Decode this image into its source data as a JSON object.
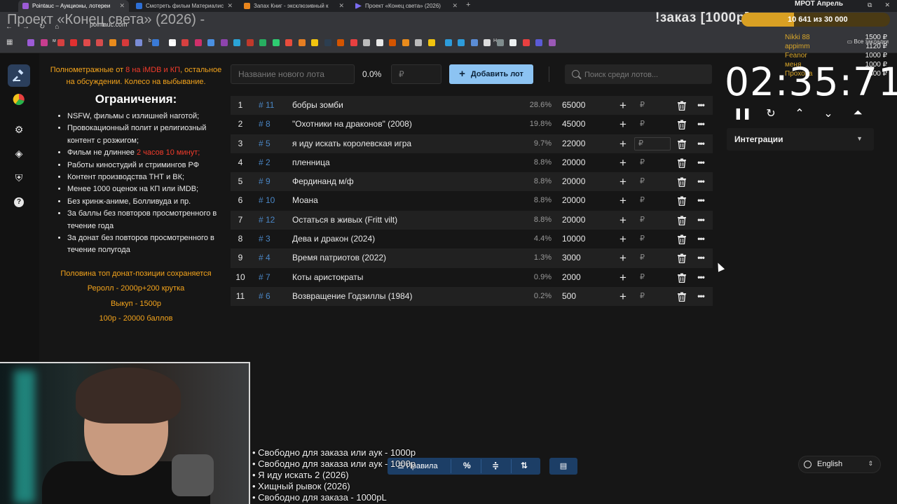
{
  "browser": {
    "tabs": [
      {
        "title": "Pointauc – Аукционы, лотереи",
        "color": "#9c5bd6"
      },
      {
        "title": "Смотреть фильм Материалис",
        "color": "#2d6fd6"
      },
      {
        "title": "Запах Книг - эксклюзивный к",
        "color": "#e8851c"
      },
      {
        "title": "Проект «Конец света» (2026)",
        "color": "#7a6cf0"
      }
    ],
    "page_title_overlay": "Проект «Конец света» (2026) -",
    "url": "pointauc.com",
    "bookmark_labels": [
      "м",
      "b",
      "m",
      "Н"
    ],
    "all_bookmarks": "Все закладки"
  },
  "stream": {
    "order_title": "!заказ [1000р]",
    "progress_text": "10 641  из 30 000",
    "progress_fraction": 0.3547,
    "mrot": "МРОТ Апрель",
    "donors": [
      "Nikki 88",
      "appimm",
      "Feanor",
      "меня",
      "Прохова"
    ],
    "donor_amounts": [
      "1500 ₽",
      "1120 ₽",
      "1000 ₽",
      "1000 ₽",
      "300 ₽"
    ],
    "ticker": [
      "• Свободно для заказа или аук - 1000р",
      "• Свободно для заказа или аук - 1000р",
      "• Я иду искать 2 (2026)",
      "• Хищный рывок (2026)",
      "• Свободно для заказа - 1000рL"
    ]
  },
  "rules": {
    "intro_a": "Полнометражные от ",
    "intro_red": "8 на iMDB и КП",
    "intro_b": ", остальное на обсуждении. Колесо на выбывание.",
    "heading": "Ограничения:",
    "items": [
      "NSFW, фильмы с излишней наготой;",
      "Провокационный полит и религиозный контент с розжигом;",
      "Фильм не длиннее ",
      "Работы киностудий и стримингов РФ",
      "Контент производства ТНТ и ВК;",
      "Менее 1000 оценок на КП или iMDB;",
      "Без кринж-аниме, Болливуда и пр.",
      "За баллы без повторов просмотренного в течение года",
      "За донат без повторов просмотренного в течение полугода"
    ],
    "length_red": "2 часов 10 минут;",
    "notes": [
      "Половина топ донат-позиции сохраняется",
      "Реролл - 2000р+200 крутка",
      "Выкуп - 1500р",
      "100р - 20000 баллов"
    ]
  },
  "toolbar": {
    "lot_placeholder": "Название нового лота",
    "percent": "0.0%",
    "money_placeholder": "₽",
    "add_label": "Добавить лот",
    "search_placeholder": "Поиск среди лотов..."
  },
  "lots": [
    {
      "idx": "1",
      "id": "# 11",
      "name": "бобры зомби",
      "pct": "28.6%",
      "amount": "65000"
    },
    {
      "idx": "2",
      "id": "# 8",
      "name": "\"Охотники на драконов\" (2008)",
      "pct": "19.8%",
      "amount": "45000"
    },
    {
      "idx": "3",
      "id": "# 5",
      "name": "я иду искать королевская игра",
      "pct": "9.7%",
      "amount": "22000"
    },
    {
      "idx": "4",
      "id": "# 2",
      "name": "пленница",
      "pct": "8.8%",
      "amount": "20000"
    },
    {
      "idx": "5",
      "id": "# 9",
      "name": "Фердинанд м/ф",
      "pct": "8.8%",
      "amount": "20000"
    },
    {
      "idx": "6",
      "id": "# 10",
      "name": "Моана",
      "pct": "8.8%",
      "amount": "20000"
    },
    {
      "idx": "7",
      "id": "# 12",
      "name": "Остаться в живых (Fritt vilt)",
      "pct": "8.8%",
      "amount": "20000"
    },
    {
      "idx": "8",
      "id": "# 3",
      "name": "Дева и дракон (2024)",
      "pct": "4.4%",
      "amount": "10000"
    },
    {
      "idx": "9",
      "id": "# 4",
      "name": "Время патриотов (2022)",
      "pct": "1.3%",
      "amount": "3000"
    },
    {
      "idx": "10",
      "id": "# 7",
      "name": "Коты аристократы",
      "pct": "0.9%",
      "amount": "2000"
    },
    {
      "idx": "11",
      "id": "# 6",
      "name": "Возвращение Годзиллы (1984)",
      "pct": "0.2%",
      "amount": "500"
    }
  ],
  "lot_currency": "₽",
  "timer": {
    "display": "02:35:71"
  },
  "integrations": {
    "label": "Интеграции"
  },
  "bottom": {
    "rules_label": "Правила",
    "percent_symbol": "%"
  },
  "language": {
    "selected": "English"
  },
  "colors": {
    "accent": "#8cc3f2",
    "rules_orange": "#f4a41c",
    "rules_red": "#f23b2b",
    "lot_id": "#4a86c5"
  }
}
